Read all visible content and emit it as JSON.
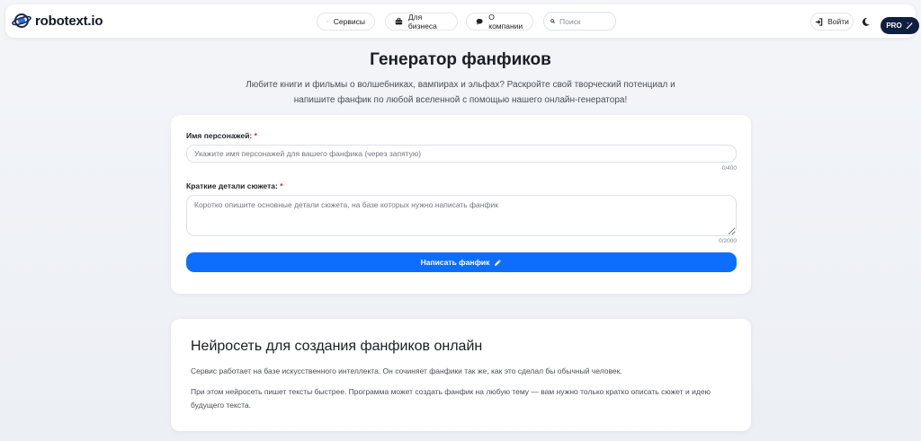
{
  "header": {
    "logo_text": "robotext.io",
    "nav": [
      {
        "label": "Сервисы",
        "icon": "magic-wand-icon"
      },
      {
        "label": "Для бизнеса",
        "icon": "briefcase-icon"
      },
      {
        "label": "О компании",
        "icon": "chat-bubble-icon"
      }
    ],
    "search_placeholder": "Поиск",
    "login_label": "Войти",
    "pro_label": "PRO"
  },
  "page": {
    "title": "Генератор фанфиков",
    "subtitle_line1": "Любите книги и фильмы о волшебниках, вампирах и эльфах? Раскройте свой творческий потенциал и",
    "subtitle_line2": "напишите фанфик по любой вселенной с помощью нашего онлайн-генератора!"
  },
  "form": {
    "characters_label": "Имя персонажей:",
    "characters_placeholder": "Укажите имя персонажей для вашего фанфика (через запятую)",
    "characters_counter": "0/400",
    "plot_label": "Краткие детали сюжета:",
    "plot_placeholder": "Коротко опишите основные детали сюжета, на базе которых нужно написать фанфик",
    "plot_counter": "0/2000",
    "required_mark": "*",
    "submit_label": "Написать фанфик"
  },
  "info": {
    "title": "Нейросеть для создания фанфиков онлайн",
    "p1": "Сервис работает на базе искусственного интеллекта. Он сочиняет фанфики так же, как это сделал бы обычный человек.",
    "p2_line1": "При этом нейросеть пишет тексты быстрее. Программа может создать фанфик на любую тему — вам нужно только кратко описать сюжет и идею",
    "p2_line2": "будущего текста."
  },
  "colors": {
    "accent": "#0d6efd",
    "pro_bg": "#0f1f3f",
    "required": "#e02424"
  }
}
